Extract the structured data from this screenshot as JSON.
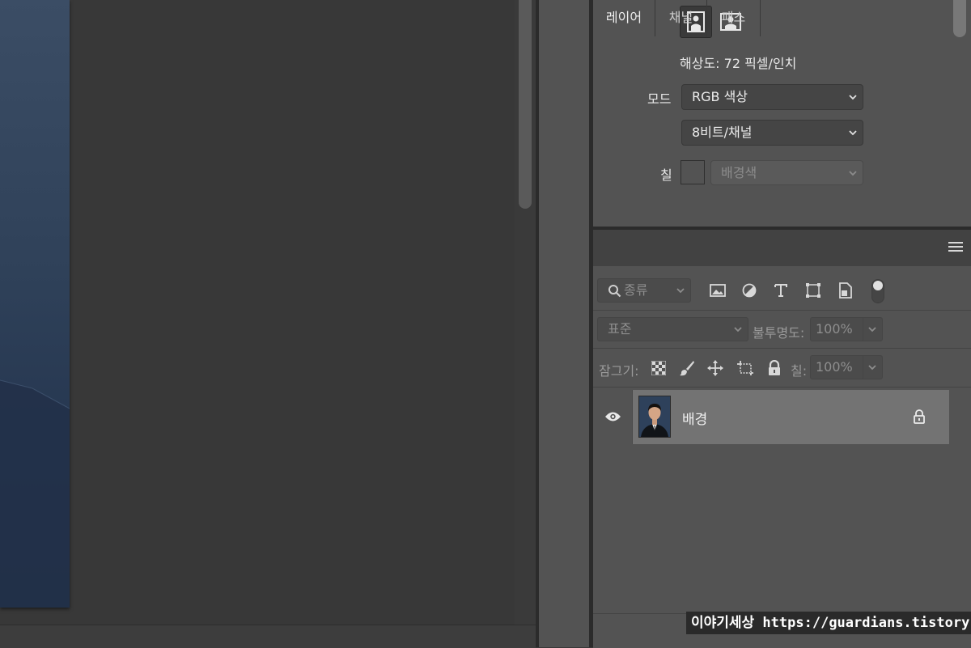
{
  "properties": {
    "resolution_label": "해상도: 72 픽셀/인치",
    "mode_label": "모드",
    "mode_value": "RGB 색상",
    "bit_depth_value": "8비트/채널",
    "fill_label": "칠",
    "fill_value": "배경색"
  },
  "layers_panel": {
    "tabs": [
      {
        "label": "레이어",
        "active": true
      },
      {
        "label": "채널",
        "active": false
      },
      {
        "label": "패스",
        "active": false
      }
    ],
    "filter_placeholder": "종류",
    "blend_mode": "표준",
    "opacity_label": "불투명도:",
    "opacity_value": "100%",
    "lock_label": "잠그기:",
    "fill_label": "칠:",
    "fill_value": "100%",
    "layers": [
      {
        "name": "배경",
        "visible": true,
        "locked": true
      }
    ]
  },
  "watermark": "이야기세상 https://guardians.tistory.com",
  "colors": {
    "panel_bg": "#535353",
    "canvas_bg": "#383838",
    "selected_layer_bg": "#737373",
    "photo_blue": "#2f4159"
  }
}
